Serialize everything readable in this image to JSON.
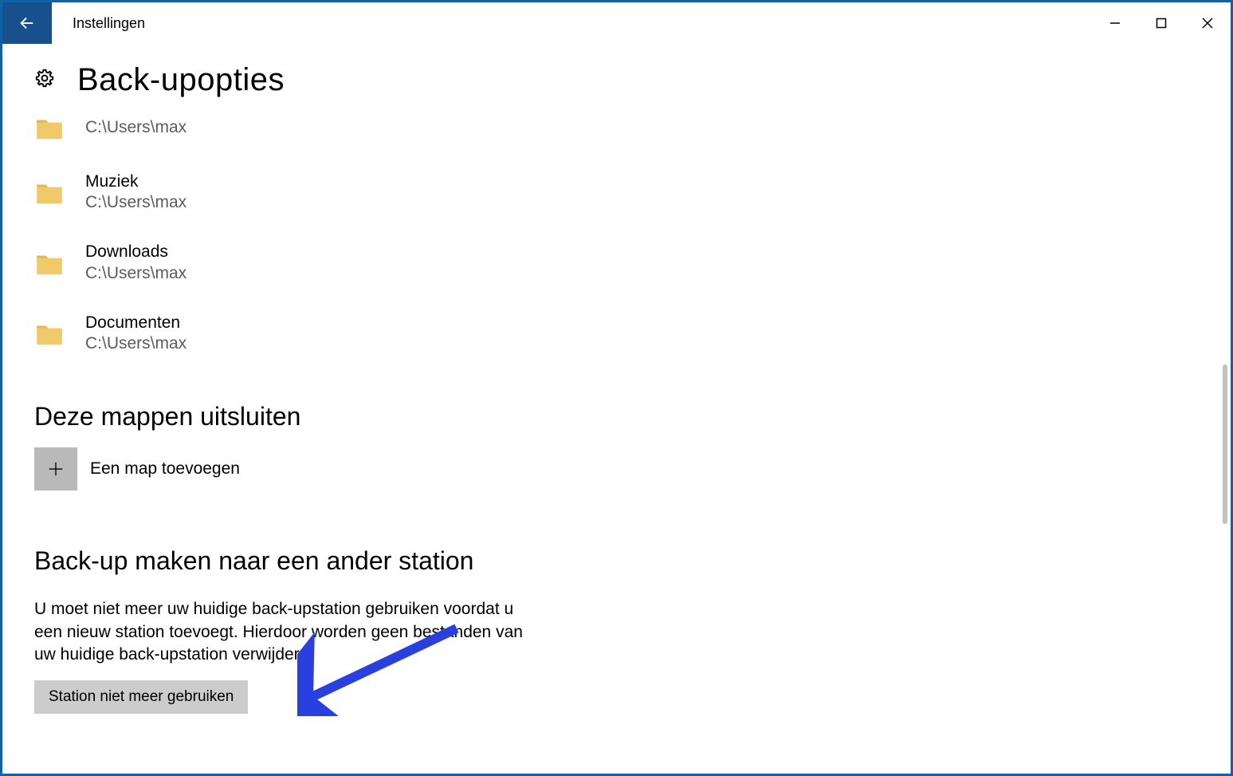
{
  "window": {
    "title": "Instellingen"
  },
  "page": {
    "title": "Back-upopties"
  },
  "folders": [
    {
      "name": "",
      "path": "C:\\Users\\max",
      "truncated": true
    },
    {
      "name": "Muziek",
      "path": "C:\\Users\\max",
      "truncated": false
    },
    {
      "name": "Downloads",
      "path": "C:\\Users\\max",
      "truncated": false
    },
    {
      "name": "Documenten",
      "path": "C:\\Users\\max",
      "truncated": false
    }
  ],
  "sections": {
    "exclude_heading": "Deze mappen uitsluiten",
    "add_folder_label": "Een map toevoegen",
    "other_drive_heading": "Back-up maken naar een ander station",
    "other_drive_info": "U moet niet meer uw huidige back-upstation gebruiken voordat u een nieuw station toevoegt. Hierdoor worden geen bestanden van uw huidige back-upstation verwijderd",
    "stop_button_label": "Station niet meer gebruiken"
  },
  "colors": {
    "accent": "#184f8d",
    "border": "#1061a8",
    "button_bg": "#cccccc",
    "plus_bg": "#b9b9b9",
    "arrow": "#2a3fe0"
  }
}
